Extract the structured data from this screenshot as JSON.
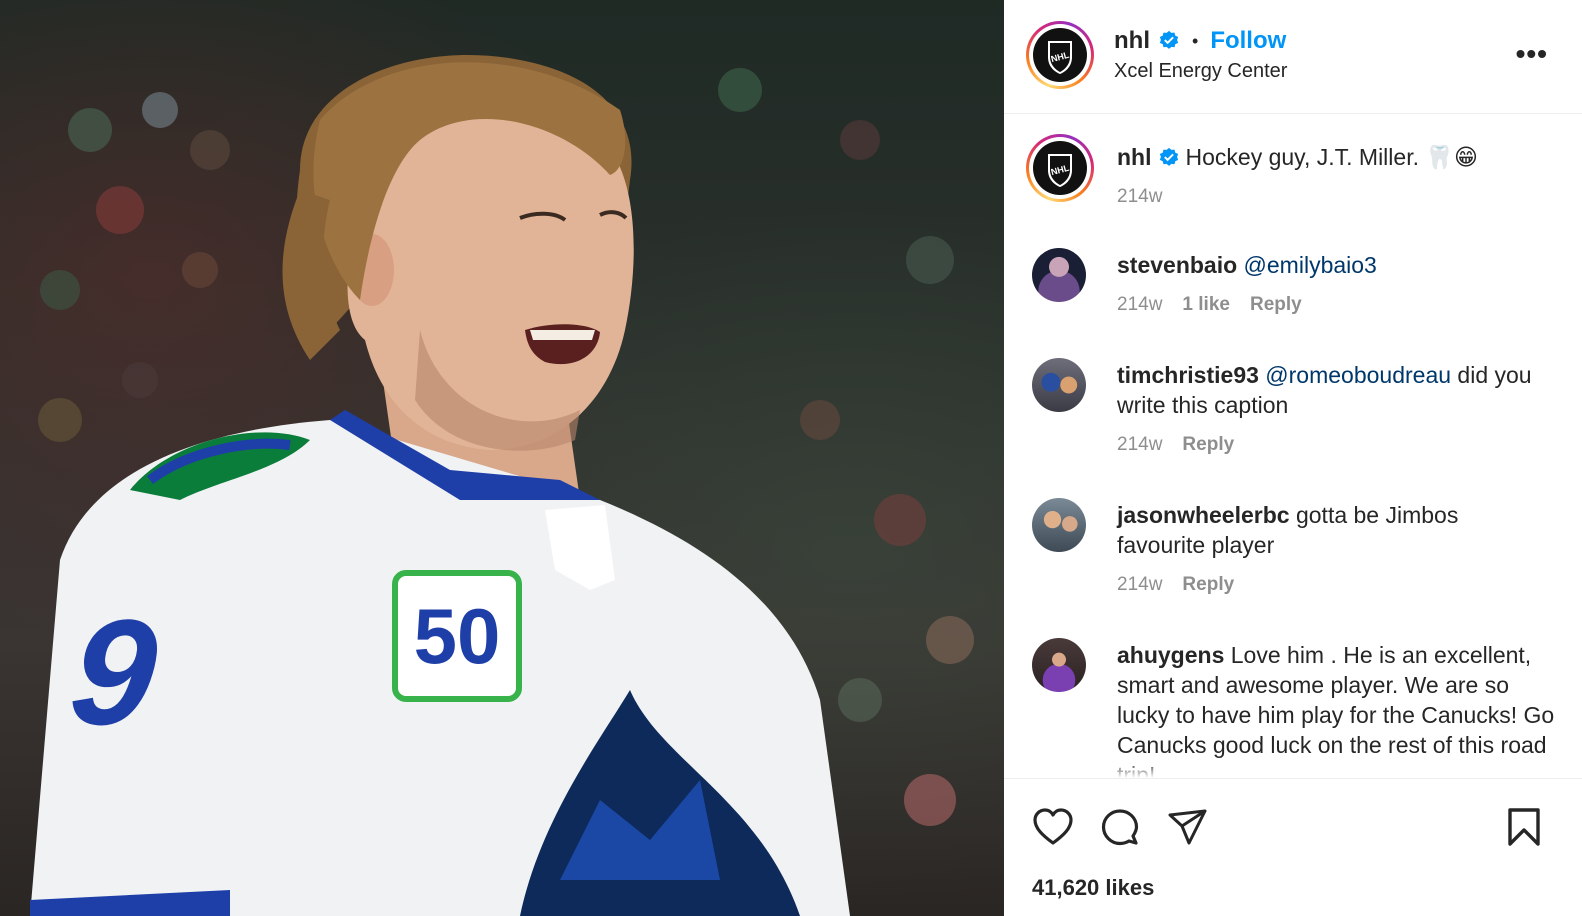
{
  "post": {
    "username": "nhl",
    "follow_label": "Follow",
    "location": "Xcel Energy Center",
    "more_label": "•••",
    "jersey_number": "9",
    "patch_text": "50",
    "photo_alt": "Hockey player in white Canucks jersey smiling"
  },
  "caption": {
    "username": "nhl",
    "text": "Hockey guy, J.T. Miller. 🦷😁",
    "time": "214w"
  },
  "comments": [
    {
      "username": "stevenbaio",
      "mention": "@emilybaio3",
      "text": "",
      "time": "214w",
      "likes": "1 like",
      "reply": "Reply"
    },
    {
      "username": "timchristie93",
      "mention": "@romeoboudreau",
      "text": " did you write this caption",
      "time": "214w",
      "likes": "",
      "reply": "Reply"
    },
    {
      "username": "jasonwheelerbc",
      "mention": "",
      "text": "gotta be Jimbos favourite player",
      "time": "214w",
      "likes": "",
      "reply": "Reply"
    },
    {
      "username": "ahuygens",
      "mention": "",
      "text": "Love him . He is an excellent, smart and awesome player. We are so lucky to have him play for the Canucks! Go Canucks good luck on the rest of this road trip!",
      "time": "",
      "likes": "",
      "reply": ""
    }
  ],
  "actions": {
    "like_icon": "heart-icon",
    "comment_icon": "comment-icon",
    "share_icon": "share-icon",
    "save_icon": "bookmark-icon",
    "likes_count": "41,620 likes"
  },
  "colors": {
    "accent": "#0095f6",
    "mention": "#00376b",
    "meta": "#8e8e8e",
    "text": "#262626"
  }
}
